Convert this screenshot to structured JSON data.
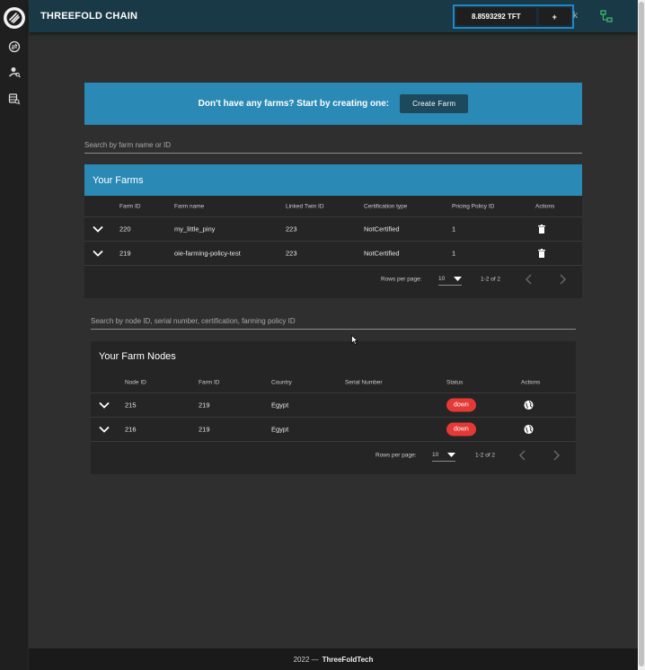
{
  "topbar": {
    "title": "THREEFOLD CHAIN",
    "balance": "8.8593292 TFT",
    "plus_label": "+",
    "partial_glyph": "k"
  },
  "sidebar": {
    "icons": [
      "logo-icon",
      "swap-icon",
      "account-search-icon",
      "database-search-icon"
    ]
  },
  "banner": {
    "text": "Don't have any farms? Start by creating one:",
    "button_label": "Create Farm"
  },
  "farm_search": {
    "placeholder": "Search by farm name or ID"
  },
  "farms": {
    "title": "Your Farms",
    "columns": [
      "Farm ID",
      "Farm name",
      "Linked Twin ID",
      "Certification type",
      "Pricing Policy ID",
      "Actions"
    ],
    "rows": [
      {
        "farm_id": "220",
        "name": "my_little_piny",
        "twin_id": "223",
        "certification": "NotCertified",
        "pricing_policy": "1"
      },
      {
        "farm_id": "219",
        "name": "oie-farming-policy-test",
        "twin_id": "223",
        "certification": "NotCertified",
        "pricing_policy": "1"
      }
    ],
    "pager": {
      "rows_label": "Rows per page:",
      "rows_value": "10",
      "range": "1-2 of 2"
    }
  },
  "node_search": {
    "placeholder": "Search by node ID, serial number, certification, farming policy ID"
  },
  "nodes": {
    "title": "Your Farm Nodes",
    "columns": [
      "Node ID",
      "Farm ID",
      "Country",
      "Serial Number",
      "Status",
      "Actions"
    ],
    "rows": [
      {
        "node_id": "215",
        "farm_id": "219",
        "country": "Egypt",
        "serial": "",
        "status": "down"
      },
      {
        "node_id": "216",
        "farm_id": "219",
        "country": "Egypt",
        "serial": "",
        "status": "down"
      }
    ],
    "pager": {
      "rows_label": "Rows per page:",
      "rows_value": "10",
      "range": "1-2 of 2"
    }
  },
  "footer": {
    "year": "2022 —",
    "brand": "ThreeFoldTech"
  },
  "colors": {
    "accent": "#2b8ab5",
    "topbar": "#1a3947",
    "status_down": "#e53935",
    "background": "#2f2f2f"
  }
}
